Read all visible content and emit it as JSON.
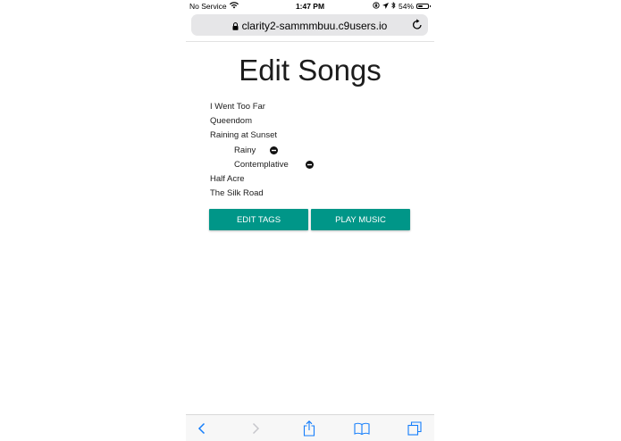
{
  "status_bar": {
    "carrier": "No Service",
    "time": "1:47 PM",
    "battery_text": "54%",
    "battery_level": 0.54,
    "icons": [
      "wifi-icon",
      "orientation-lock-icon",
      "location-icon",
      "bluetooth-icon",
      "battery-icon"
    ]
  },
  "browser": {
    "url": "clarity2-sammmbuu.c9users.io",
    "icons": [
      "lock-icon",
      "reload-icon"
    ]
  },
  "page": {
    "title": "Edit Songs",
    "songs": [
      {
        "title": "I Went Too Far",
        "tags": []
      },
      {
        "title": "Queendom",
        "tags": []
      },
      {
        "title": "Raining at Sunset",
        "tags": [
          "Rainy",
          "Contemplative"
        ]
      },
      {
        "title": "Half Acre",
        "tags": []
      },
      {
        "title": "The Silk Road",
        "tags": []
      }
    ],
    "buttons": {
      "edit_tags": "EDIT TAGS",
      "play_music": "PLAY MUSIC"
    }
  },
  "toolbar": {
    "icons": [
      "back-icon",
      "forward-icon",
      "share-icon",
      "bookmarks-icon",
      "tabs-icon"
    ]
  },
  "colors": {
    "accent": "#009688",
    "text": "#1c1c1c",
    "toolbar_icon": "#147efb"
  }
}
